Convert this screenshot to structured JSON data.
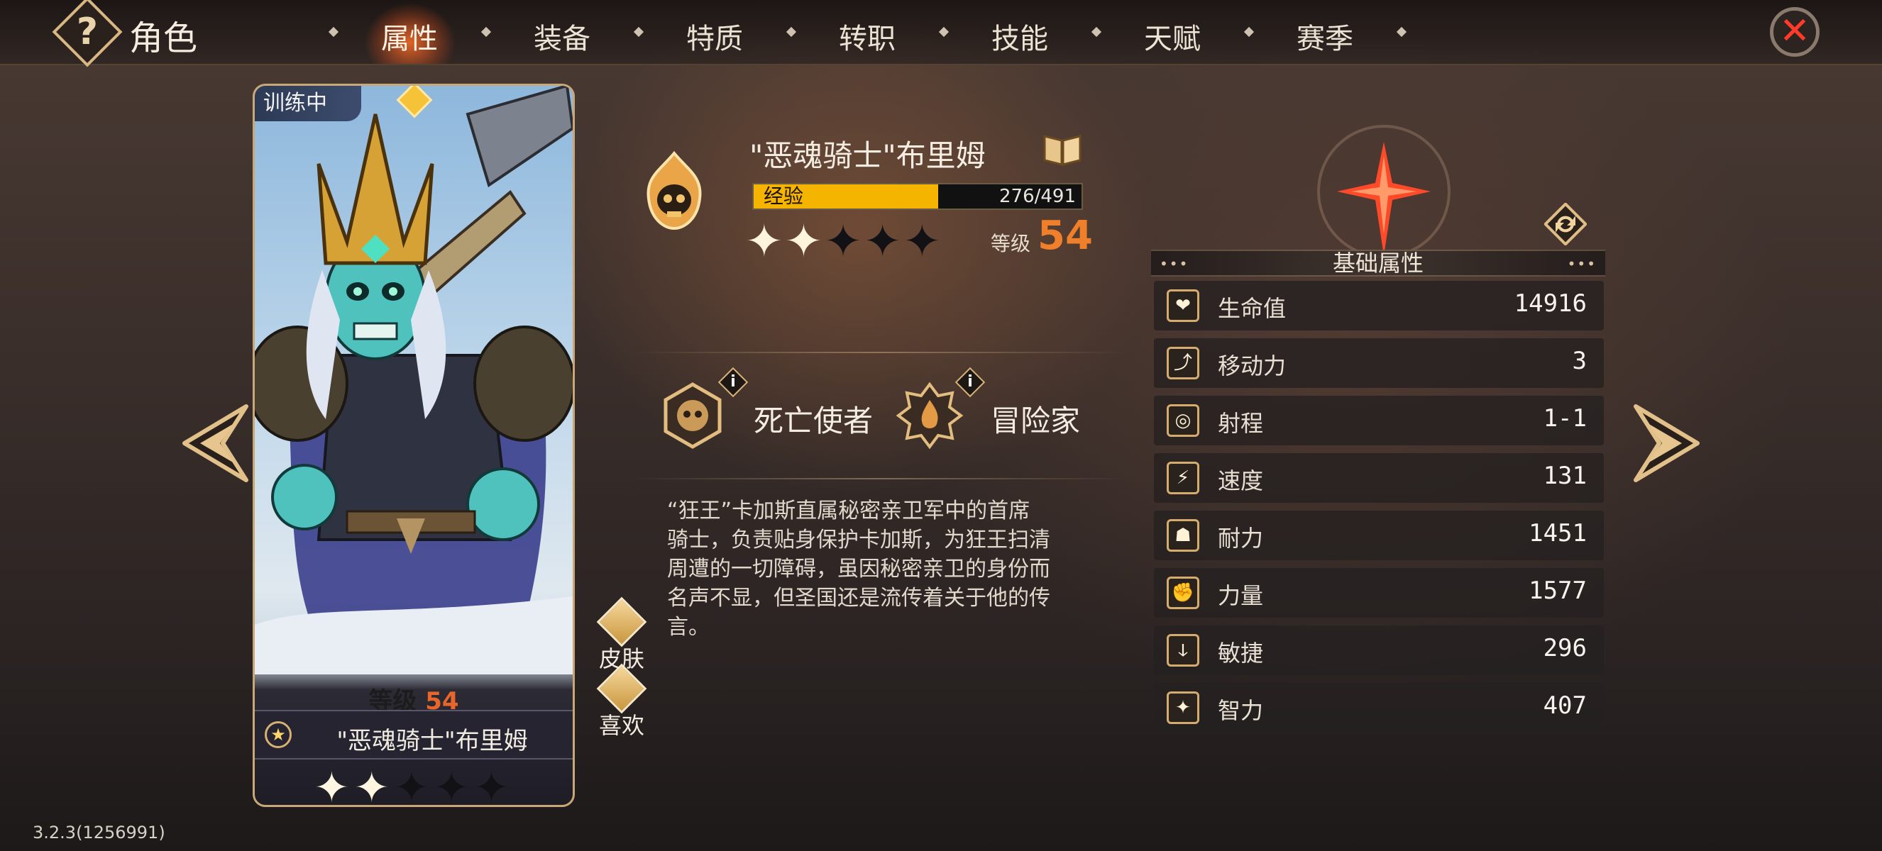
{
  "header": {
    "title": "角色",
    "help_icon": "?",
    "tabs": [
      {
        "label": "属性",
        "active": true
      },
      {
        "label": "装备"
      },
      {
        "label": "特质"
      },
      {
        "label": "转职"
      },
      {
        "label": "技能"
      },
      {
        "label": "天赋"
      },
      {
        "label": "赛季"
      }
    ],
    "close_icon": "✕"
  },
  "hero_card": {
    "status_badge": "训练中",
    "level_label": "等级",
    "level": "54",
    "name": "\"恶魂骑士\"布里姆",
    "stars": "✦✦✦✦✦",
    "star_icon": "★"
  },
  "side_buttons": {
    "skin_label": "皮肤",
    "like_label": "喜欢"
  },
  "hero_info": {
    "name": "\"恶魂骑士\"布里姆",
    "exp_label": "经验",
    "exp_value": "276/491",
    "exp_current": 276,
    "exp_max": 491,
    "rank_stars": "✦✦✦✦✦",
    "rank_filled": 2,
    "rank_total": 5,
    "level_caption": "等级",
    "level": "54",
    "traits": [
      {
        "name": "死亡使者",
        "info": "i"
      },
      {
        "name": "冒险家",
        "info": "i"
      }
    ],
    "bio": "“狂王”卡加斯直属秘密亲卫军中的首席骑士，负责贴身保护卡加斯，为狂王扫清周遭的一切障碍，虽因秘密亲卫的身份而名声不显，但圣国还是流传着关于他的传言。"
  },
  "attributes": {
    "title": "基础属性",
    "dots": "•••",
    "rows": [
      {
        "label": "生命值",
        "value": "14916",
        "icon": "❤"
      },
      {
        "label": "移动力",
        "value": "3",
        "icon": "⤴"
      },
      {
        "label": "射程",
        "value": "1-1",
        "icon": "◎"
      },
      {
        "label": "速度",
        "value": "131",
        "icon": "⚡"
      },
      {
        "label": "耐力",
        "value": "1451",
        "icon": "☗"
      },
      {
        "label": "力量",
        "value": "1577",
        "icon": "✊"
      },
      {
        "label": "敏捷",
        "value": "296",
        "icon": "ↆ"
      },
      {
        "label": "智力",
        "value": "407",
        "icon": "✦"
      }
    ]
  },
  "footer": {
    "version": "3.2.3(1256991)"
  },
  "colors": {
    "accent_orange": "#ef7f2b",
    "exp_bar": "#f4b400",
    "gold": "#d4ad6e",
    "close_red": "#ff3b2b"
  }
}
